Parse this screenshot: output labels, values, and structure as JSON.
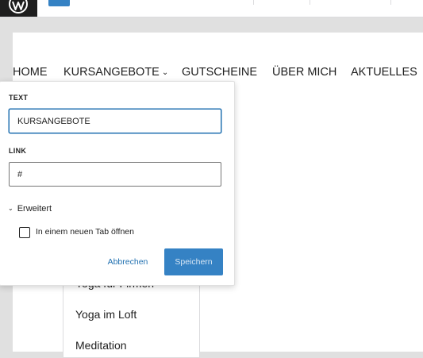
{
  "colors": {
    "accent": "#2271b1",
    "save_button": "#3582c4",
    "admin_dark": "#1e1e1e"
  },
  "toolbar": {
    "logo_icon": "wordpress-logo-icon"
  },
  "nav": {
    "items": [
      {
        "label": "HOME"
      },
      {
        "label": "KURSANGEBOTE",
        "has_submenu": true,
        "icon": "chevron-down-icon"
      },
      {
        "label": "GUTSCHEINE"
      },
      {
        "label": "ÜBER MICH"
      },
      {
        "label": "AKTUELLES"
      }
    ]
  },
  "submenu": {
    "items": [
      {
        "label": "Yoga für Firmen"
      },
      {
        "label": "Yoga im Loft"
      },
      {
        "label": "Meditation"
      }
    ]
  },
  "link_popover": {
    "text_label": "TEXT",
    "text_value": "KURSANGEBOTE",
    "link_label": "LINK",
    "link_value": "#",
    "advanced_label": "Erweitert",
    "advanced_icon": "chevron-down-icon",
    "new_tab_label": "In einem neuen Tab öffnen",
    "new_tab_checked": false,
    "cancel_label": "Abbrechen",
    "save_label": "Speichern"
  }
}
